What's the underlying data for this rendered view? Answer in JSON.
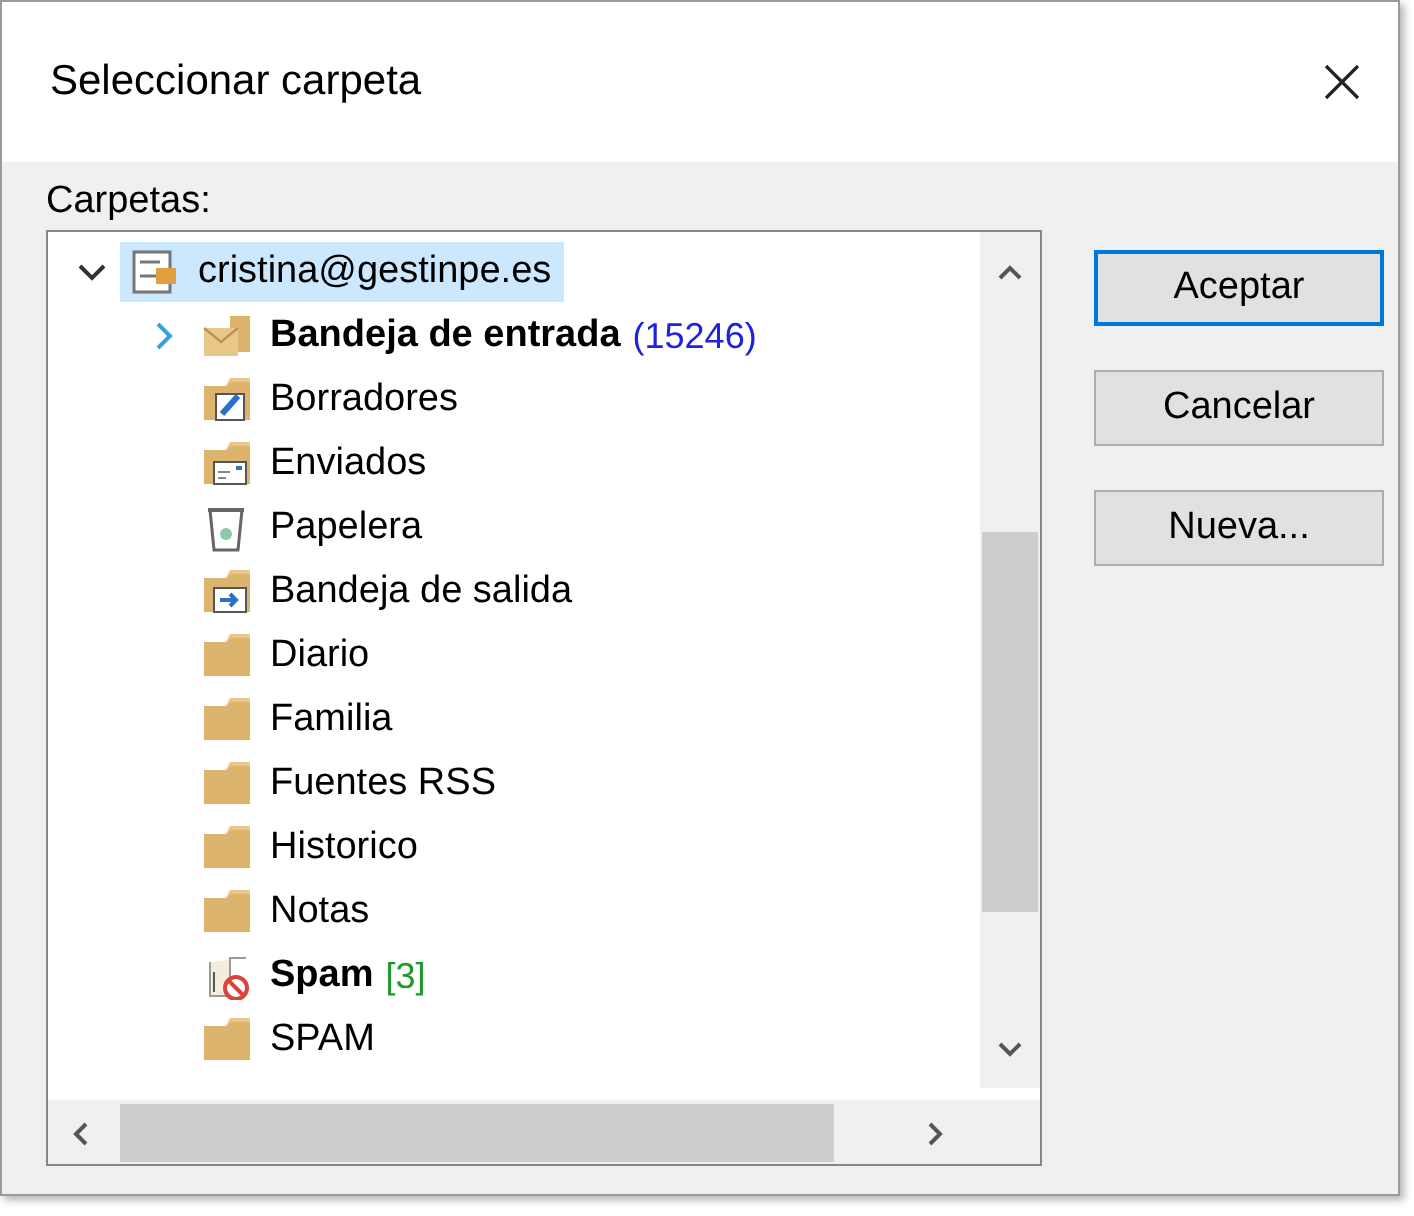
{
  "window": {
    "title": "Seleccionar carpeta"
  },
  "folders_label": "Carpetas:",
  "tree": [
    {
      "label": "cristina@gestinpe.es",
      "kind": "account",
      "selected": true,
      "expanded": true,
      "bold": false,
      "children": [
        {
          "label": "Bandeja de entrada",
          "kind": "inbox",
          "selected": false,
          "expanded": false,
          "bold": true,
          "count": {
            "text": "(15246)",
            "color": "#2020e0"
          }
        },
        {
          "label": "Borradores",
          "kind": "drafts",
          "selected": false,
          "bold": false
        },
        {
          "label": "Enviados",
          "kind": "sent",
          "selected": false,
          "bold": false
        },
        {
          "label": "Papelera",
          "kind": "trash",
          "selected": false,
          "bold": false
        },
        {
          "label": "Bandeja de salida",
          "kind": "outbox",
          "selected": false,
          "bold": false
        },
        {
          "label": "Diario",
          "kind": "folder",
          "selected": false,
          "bold": false
        },
        {
          "label": "Familia",
          "kind": "folder",
          "selected": false,
          "bold": false
        },
        {
          "label": "Fuentes RSS",
          "kind": "folder",
          "selected": false,
          "bold": false
        },
        {
          "label": "Historico",
          "kind": "folder",
          "selected": false,
          "bold": false
        },
        {
          "label": "Notas",
          "kind": "folder",
          "selected": false,
          "bold": false
        },
        {
          "label": "Spam",
          "kind": "junk",
          "selected": false,
          "bold": true,
          "count": {
            "text": "[3]",
            "color": "#1f9a2a"
          }
        },
        {
          "label": "SPAM",
          "kind": "folder",
          "selected": false,
          "bold": false
        }
      ]
    }
  ],
  "buttons": [
    {
      "label": "Aceptar",
      "default": true
    },
    {
      "label": "Cancelar",
      "default": false
    },
    {
      "label": "Nueva...",
      "default": false
    }
  ]
}
